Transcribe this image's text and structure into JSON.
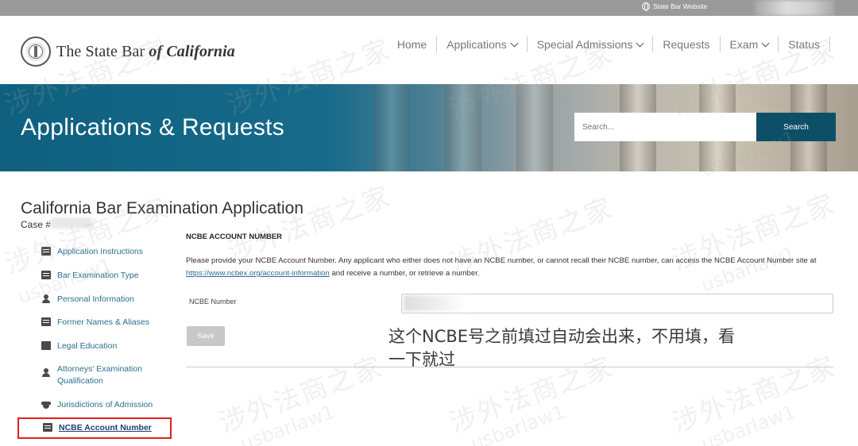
{
  "topbar": {
    "site_link": "State Bar Website",
    "icon": "globe-icon"
  },
  "header": {
    "logo_text_plain": "The State Bar ",
    "logo_text_em": "of California",
    "nav": [
      {
        "label": "Home",
        "dropdown": false
      },
      {
        "label": "Applications",
        "dropdown": true
      },
      {
        "label": "Special Admissions",
        "dropdown": true
      },
      {
        "label": "Requests",
        "dropdown": false
      },
      {
        "label": "Exam",
        "dropdown": true
      },
      {
        "label": "Status",
        "dropdown": false
      }
    ]
  },
  "banner": {
    "title": "Applications & Requests",
    "search_placeholder": "Search...",
    "search_button": "Search"
  },
  "main": {
    "page_title": "California Bar Examination Application",
    "case_label": "Case #"
  },
  "sidebar": {
    "items": [
      {
        "label": "Application Instructions",
        "icon": "document-icon"
      },
      {
        "label": "Bar Examination Type",
        "icon": "copy-icon"
      },
      {
        "label": "Personal Information",
        "icon": "person-icon"
      },
      {
        "label": "Former Names & Aliases",
        "icon": "id-card-icon"
      },
      {
        "label": "Legal Education",
        "icon": "briefcase-icon"
      },
      {
        "label": "Attorneys' Examination Qualification",
        "icon": "user-tie-icon"
      },
      {
        "label": "Jurisdictions of Admission",
        "icon": "graduation-cap-icon"
      },
      {
        "label": "NCBE Account Number",
        "icon": "edit-icon",
        "active": true
      }
    ]
  },
  "form": {
    "section_heading": "NCBE ACCOUNT NUMBER",
    "desc_before": "Please provide your NCBE Account Number. Any applicant who either does not have an NCBE number, or cannot recall their NCBE number, can access the NCBE Account Number site at ",
    "desc_link": "https://www.ncbex.org/account-information",
    "desc_after": " and receive a number, or retrieve a number.",
    "field_label": "NCBE Number",
    "save_label": "Save"
  },
  "annotation": {
    "note": "这个NCBE号之前填过自动会出来，不用填，看一下就过"
  },
  "watermark": {
    "text": "涉外法商之家",
    "handle": "usbarlaw1"
  },
  "colors": {
    "banner_blue": "#176a8a",
    "search_button": "#0e4f68",
    "link": "#2b6e8f",
    "highlight_border": "#e02020"
  }
}
